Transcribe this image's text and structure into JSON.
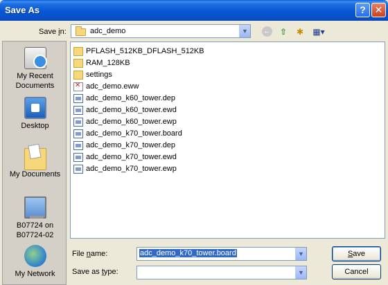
{
  "window": {
    "title": "Save As",
    "help_glyph": "?",
    "close_glyph": "✕"
  },
  "toolbar": {
    "save_in_label_pre": "Save ",
    "save_in_label_u": "i",
    "save_in_label_post": "n:",
    "save_in_value": "adc_demo",
    "icons": [
      "back-icon",
      "up-folder-icon",
      "new-folder-icon",
      "views-menu-icon"
    ]
  },
  "places": [
    {
      "id": "recent",
      "label_line1": "My Recent",
      "label_line2": "Documents",
      "icon": "my-recent-documents-icon"
    },
    {
      "id": "desktop",
      "label_line1": "Desktop",
      "label_line2": "",
      "icon": "desktop-icon"
    },
    {
      "id": "documents",
      "label_line1": "My Documents",
      "label_line2": "",
      "icon": "my-documents-icon"
    },
    {
      "id": "computer",
      "label_line1": "B07724 on",
      "label_line2": "B07724-02",
      "icon": "my-computer-icon"
    },
    {
      "id": "network",
      "label_line1": "My Network",
      "label_line2": "",
      "icon": "my-network-icon"
    }
  ],
  "files": [
    {
      "name": "PFLASH_512KB_DFLASH_512KB",
      "type": "folder"
    },
    {
      "name": "RAM_128KB",
      "type": "folder"
    },
    {
      "name": "settings",
      "type": "folder"
    },
    {
      "name": "adc_demo.eww",
      "type": "eww"
    },
    {
      "name": "adc_demo_k60_tower.dep",
      "type": "file"
    },
    {
      "name": "adc_demo_k60_tower.ewd",
      "type": "file"
    },
    {
      "name": "adc_demo_k60_tower.ewp",
      "type": "file"
    },
    {
      "name": "adc_demo_k70_tower.board",
      "type": "file"
    },
    {
      "name": "adc_demo_k70_tower.dep",
      "type": "file"
    },
    {
      "name": "adc_demo_k70_tower.ewd",
      "type": "file"
    },
    {
      "name": "adc_demo_k70_tower.ewp",
      "type": "file"
    }
  ],
  "form": {
    "file_name_label_pre": "File ",
    "file_name_label_u": "n",
    "file_name_label_post": "ame:",
    "file_name_value": "adc_demo_k70_tower.board",
    "save_type_label_pre": "Save as ",
    "save_type_label_u": "t",
    "save_type_label_post": "ype:",
    "save_type_value": ""
  },
  "buttons": {
    "save_u": "S",
    "save_rest": "ave",
    "cancel": "Cancel"
  }
}
